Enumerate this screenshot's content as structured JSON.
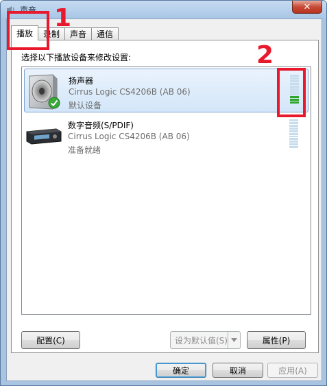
{
  "window": {
    "title": "声音",
    "close_label": "✕"
  },
  "tabs": [
    {
      "label": "播放"
    },
    {
      "label": "录制"
    },
    {
      "label": "声音"
    },
    {
      "label": "通信"
    }
  ],
  "panel": {
    "instruction": "选择以下播放设备来修改设置:"
  },
  "devices": [
    {
      "name": "扬声器",
      "description": "Cirrus Logic CS4206B (AB 06)",
      "status": "默认设备",
      "selected": true,
      "default_check": true,
      "level_segments_on": 3,
      "level_segments_total": 11
    },
    {
      "name": "数字音频(S/PDIF)",
      "description": "Cirrus Logic CS4206B (AB 06)",
      "status": "准备就绪",
      "selected": false,
      "default_check": false,
      "level_segments_on": 0,
      "level_segments_total": 11
    }
  ],
  "buttons": {
    "configure": "配置(C)",
    "set_default": "设为默认值(S)",
    "properties": "属性(P)",
    "ok": "确定",
    "cancel": "取消",
    "apply": "应用(A)"
  },
  "annotations": [
    {
      "label": "1"
    },
    {
      "label": "2"
    }
  ],
  "colors": {
    "annotation": "#e8192c",
    "meter_on": "#2fa52a",
    "meter_off": "#c7dced"
  }
}
